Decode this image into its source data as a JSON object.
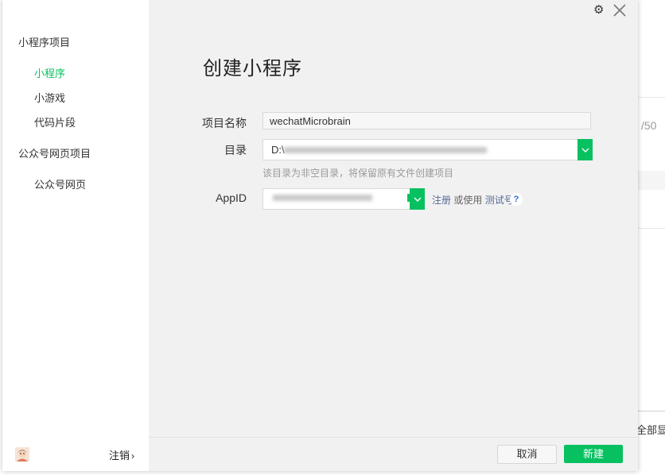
{
  "background": {
    "counter_text": "/50",
    "show_all_text": "全部显示"
  },
  "sidebar": {
    "group_miniprogram": "小程序项目",
    "items_miniprogram": [
      {
        "label": "小程序",
        "active": true
      },
      {
        "label": "小游戏",
        "active": false
      },
      {
        "label": "代码片段",
        "active": false
      }
    ],
    "group_official": "公众号网页项目",
    "items_official": [
      {
        "label": "公众号网页",
        "active": false
      }
    ],
    "logout_label": "注销"
  },
  "dialog": {
    "title": "创建小程序",
    "project_name_label": "项目名称",
    "project_name_value": "wechatMicrobrain",
    "directory_label": "目录",
    "directory_value": "D:\\",
    "directory_hint": "该目录为非空目录，将保留原有文件创建项目",
    "appid_label": "AppID",
    "register_link": "注册",
    "or_use_text": "或使用",
    "test_account_link": "测试号",
    "help_glyph": "?",
    "cancel_label": "取消",
    "create_label": "新建"
  },
  "colors": {
    "accent": "#07c160",
    "link": "#576b95",
    "panel_bg": "#f1f1f2"
  },
  "icons": {
    "settings": "gear-icon",
    "close": "close-icon",
    "dropdown": "chevron-down-icon",
    "help": "question-icon"
  }
}
